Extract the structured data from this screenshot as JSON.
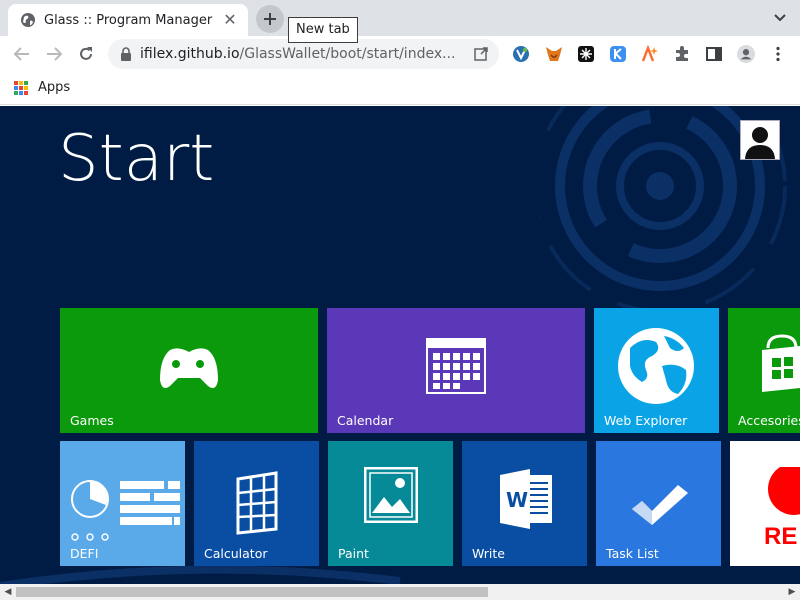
{
  "browser": {
    "tab": {
      "title": "Glass :: Program Manager",
      "close_glyph": "✕",
      "favicon": "globe-icon"
    },
    "new_tab_tooltip": "New tab",
    "omnibox": {
      "host": "ifilex.github.io",
      "path": "/GlassWallet/boot/start/index..."
    },
    "extensions": [
      "vivaldi-v-icon",
      "metamask-fox-icon",
      "mask-network-icon",
      "keplr-k-icon",
      "ai-spark-icon",
      "puzzle-extensions-icon",
      "side-panel-icon",
      "profile-icon",
      "more-menu-icon"
    ],
    "bookmarks": {
      "apps_label": "Apps"
    }
  },
  "page": {
    "title": "Start",
    "background_color": "#001c44",
    "tiles_row1": [
      {
        "id": "games",
        "label": "Games",
        "color": "#0b9a0b",
        "icon": "gamepad-icon"
      },
      {
        "id": "calendar",
        "label": "Calendar",
        "color": "#5b38b8",
        "icon": "calendar-icon"
      },
      {
        "id": "web-explorer",
        "label": "Web Explorer",
        "color": "#0aa3e6",
        "icon": "globe-icon"
      },
      {
        "id": "accessories",
        "label": "Accesories",
        "color": "#0b9a0b",
        "icon": "store-bag-icon"
      }
    ],
    "tiles_row2": [
      {
        "id": "defi",
        "label": "DEFI",
        "color": "#5aa9e8",
        "icon": "dashboard-icon"
      },
      {
        "id": "calculator",
        "label": "Calculator",
        "color": "#0a4ea3",
        "icon": "calculator-icon"
      },
      {
        "id": "paint",
        "label": "Paint",
        "color": "#078a97",
        "icon": "picture-icon"
      },
      {
        "id": "write",
        "label": "Write",
        "color": "#0a4ea3",
        "icon": "word-icon"
      },
      {
        "id": "task-list",
        "label": "Task List",
        "color": "#2a77e0",
        "icon": "checkmark-icon"
      },
      {
        "id": "record",
        "label": "RE",
        "color": "#ffffff",
        "icon": "record-icon"
      }
    ]
  }
}
